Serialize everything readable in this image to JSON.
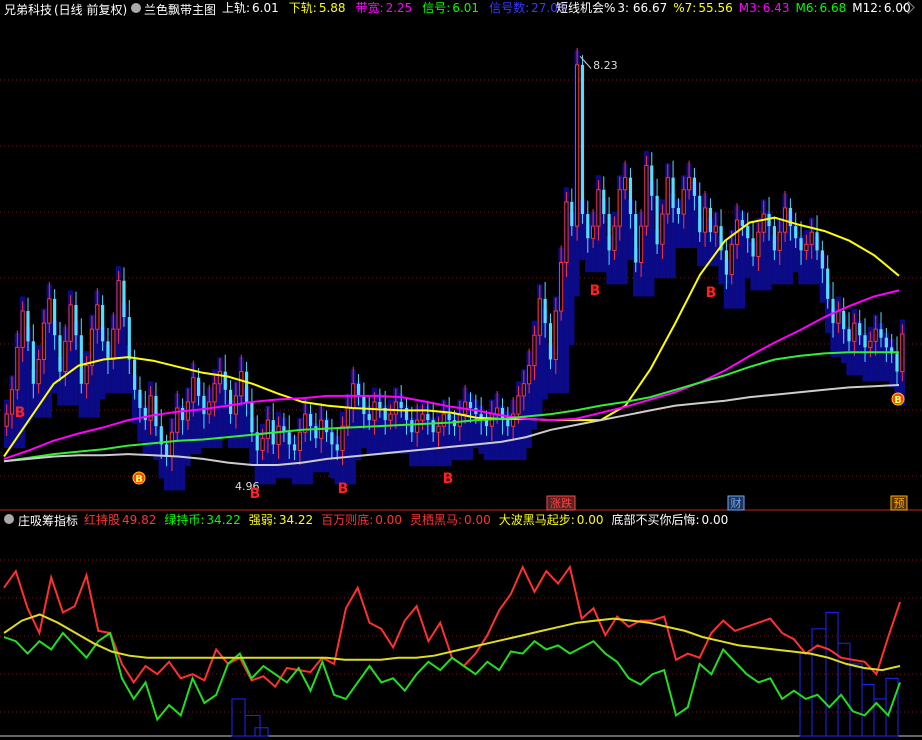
{
  "header": {
    "stock_name": "兄弟科技",
    "period": "(日线 前复权)",
    "indicator_name": "兰色飘带主图",
    "items": [
      {
        "label": "上轨:",
        "value": "6.01",
        "color": "#ffffff"
      },
      {
        "label": "下轨:",
        "value": "5.88",
        "color": "#ffff00"
      },
      {
        "label": "带宽:",
        "value": "2.25",
        "color": "#ff00ff"
      },
      {
        "label": "信号:",
        "value": "6.01",
        "color": "#00ff00"
      },
      {
        "label": "信号数:",
        "value": "27.00",
        "color": "#3a3aff"
      }
    ],
    "ma": [
      {
        "label": "短线机会%",
        "value": "3: 66.67",
        "color": "#ffffff"
      },
      {
        "label": "%7:",
        "value": "55.56",
        "color": "#ffff00"
      },
      {
        "label": "M3:",
        "value": "6.43",
        "color": "#ff00ff"
      },
      {
        "label": "M6:",
        "value": "6.68",
        "color": "#00ff00"
      },
      {
        "label": "M12:",
        "value": "6.00",
        "color": "#ffffff"
      }
    ]
  },
  "sub_header": {
    "indicator_name": "庄吸筹指标",
    "items": [
      {
        "label": "红持股",
        "value": "49.82",
        "color": "#ff3333"
      },
      {
        "label": "绿持币:",
        "value": "34.22",
        "color": "#00ff00"
      },
      {
        "label": "强弱:",
        "value": "34.22",
        "color": "#ffff00"
      },
      {
        "label": "百万则底:",
        "value": "0.00",
        "color": "#ff3333"
      },
      {
        "label": "灵栖黑马:",
        "value": "0.00",
        "color": "#ff3333"
      },
      {
        "label": "大波黑马起步:",
        "value": "0.00",
        "color": "#ffff00"
      },
      {
        "label": "底部不买你后悔:",
        "value": "0.00",
        "color": "#ffffff"
      }
    ]
  },
  "annotations": {
    "high_label": "8.23",
    "low_label": "4.96",
    "b_mark": "B",
    "b_circle_mark": "B",
    "events": [
      {
        "text": "涨跌",
        "color": "#ff4444",
        "bg": "#552222"
      },
      {
        "text": "财",
        "color": "#66aaff",
        "bg": "#223355"
      },
      {
        "text": "预",
        "color": "#ffaa00",
        "bg": "#553311"
      }
    ]
  },
  "chart_data": [
    {
      "type": "candlestick",
      "title": "兰色飘带主图",
      "ylim": [
        4.6,
        8.6
      ],
      "close": [
        5.35,
        5.55,
        5.9,
        6.2,
        5.95,
        5.6,
        5.8,
        6.1,
        6.3,
        6.0,
        5.7,
        5.95,
        6.25,
        6.0,
        5.6,
        5.75,
        6.05,
        6.25,
        5.95,
        5.8,
        6.05,
        6.45,
        6.15,
        5.8,
        5.55,
        5.4,
        5.3,
        5.5,
        5.25,
        5.1,
        5.0,
        5.2,
        5.4,
        5.3,
        5.45,
        5.65,
        5.5,
        5.35,
        5.45,
        5.6,
        5.7,
        5.55,
        5.35,
        5.5,
        5.7,
        5.45,
        5.2,
        5.05,
        5.15,
        5.3,
        5.1,
        5.25,
        5.2,
        5.1,
        5.05,
        5.2,
        5.35,
        5.25,
        5.15,
        5.3,
        5.2,
        5.1,
        5.05,
        5.25,
        5.4,
        5.6,
        5.5,
        5.35,
        5.3,
        5.45,
        5.4,
        5.3,
        5.35,
        5.45,
        5.4,
        5.3,
        5.2,
        5.3,
        5.35,
        5.3,
        5.2,
        5.25,
        5.35,
        5.3,
        5.25,
        5.35,
        5.45,
        5.4,
        5.35,
        5.3,
        5.25,
        5.35,
        5.4,
        5.3,
        5.25,
        5.35,
        5.5,
        5.6,
        5.75,
        6.0,
        6.3,
        6.1,
        5.8,
        6.2,
        6.6,
        7.1,
        6.9,
        8.23,
        7.0,
        6.8,
        6.9,
        7.2,
        7.0,
        6.7,
        6.9,
        7.2,
        7.3,
        7.0,
        6.6,
        6.9,
        7.4,
        7.15,
        6.75,
        7.0,
        7.3,
        7.05,
        7.0,
        7.2,
        7.3,
        7.15,
        6.85,
        7.05,
        6.85,
        6.9,
        6.7,
        6.5,
        6.75,
        6.95,
        6.9,
        6.8,
        6.65,
        6.85,
        7.0,
        6.9,
        6.7,
        6.85,
        7.05,
        6.9,
        6.8,
        6.7,
        6.75,
        6.85,
        6.7,
        6.55,
        6.3,
        6.1,
        6.2,
        6.05,
        5.95,
        6.1,
        6.0,
        5.9,
        5.95,
        6.05,
        5.98,
        5.9,
        5.85,
        5.7,
        6.01
      ],
      "series": [
        {
          "name": "",
          "color": "#ffff00",
          "values": [
            5.0,
            5.3,
            5.6,
            5.75,
            5.8,
            5.82,
            5.79,
            5.74,
            5.69,
            5.66,
            5.6,
            5.52,
            5.45,
            5.42,
            5.4,
            5.39,
            5.38,
            5.38,
            5.36,
            5.32,
            5.31,
            5.31,
            5.3,
            5.3,
            5.3,
            5.42,
            5.72,
            6.1,
            6.5,
            6.78,
            6.93,
            6.97,
            6.91,
            6.86,
            6.78,
            6.66,
            6.49
          ]
        },
        {
          "name": "",
          "color": "#ff00ff",
          "values": [
            4.98,
            5.05,
            5.13,
            5.19,
            5.24,
            5.3,
            5.34,
            5.37,
            5.39,
            5.42,
            5.45,
            5.47,
            5.48,
            5.5,
            5.5,
            5.5,
            5.49,
            5.45,
            5.41,
            5.38,
            5.34,
            5.31,
            5.3,
            5.31,
            5.36,
            5.41,
            5.47,
            5.53,
            5.61,
            5.71,
            5.83,
            5.94,
            6.04,
            6.15,
            6.24,
            6.32,
            6.37
          ]
        },
        {
          "name": "",
          "color": "#33ee33",
          "values": [
            4.96,
            4.99,
            5.02,
            5.04,
            5.06,
            5.09,
            5.11,
            5.13,
            5.14,
            5.16,
            5.18,
            5.2,
            5.22,
            5.23,
            5.24,
            5.25,
            5.26,
            5.27,
            5.28,
            5.3,
            5.31,
            5.33,
            5.35,
            5.38,
            5.42,
            5.45,
            5.49,
            5.55,
            5.61,
            5.67,
            5.74,
            5.8,
            5.83,
            5.85,
            5.86,
            5.86,
            5.86
          ]
        },
        {
          "name": "",
          "color": "#cccccc",
          "values": [
            4.96,
            4.98,
            5.0,
            5.01,
            5.01,
            5.02,
            5.01,
            5.0,
            4.98,
            4.95,
            4.93,
            4.93,
            4.95,
            4.98,
            5.0,
            5.02,
            5.04,
            5.06,
            5.08,
            5.1,
            5.12,
            5.16,
            5.22,
            5.26,
            5.3,
            5.34,
            5.38,
            5.42,
            5.44,
            5.46,
            5.49,
            5.51,
            5.53,
            5.55,
            5.57,
            5.58,
            5.59
          ]
        }
      ]
    },
    {
      "type": "line",
      "title": "庄吸筹指标",
      "ylim": [
        0,
        100
      ],
      "series": [
        {
          "name": "红持股",
          "color": "#ff3030",
          "values": [
            72,
            80,
            62,
            50,
            77,
            60,
            63,
            78,
            51,
            50,
            35,
            26,
            34,
            30,
            36,
            28,
            30,
            27,
            42,
            35,
            38,
            27,
            29,
            24,
            33,
            32,
            31,
            38,
            35,
            62,
            72,
            55,
            52,
            43,
            56,
            63,
            46,
            55,
            38,
            34,
            40,
            49,
            61,
            69,
            82,
            70,
            80,
            74,
            82,
            57,
            62,
            49,
            58,
            53,
            56,
            56,
            58,
            37,
            40,
            38,
            50,
            56,
            51,
            53,
            55,
            57,
            50,
            47,
            40,
            44,
            42,
            38,
            37,
            36,
            30,
            48,
            65
          ]
        },
        {
          "name": "绿持币",
          "color": "#22dd22",
          "values": [
            48,
            46,
            40,
            46,
            42,
            50,
            44,
            38,
            46,
            50,
            28,
            18,
            26,
            8,
            15,
            10,
            28,
            16,
            20,
            35,
            40,
            28,
            34,
            30,
            26,
            33,
            22,
            36,
            20,
            18,
            26,
            34,
            26,
            28,
            22,
            30,
            36,
            32,
            38,
            34,
            30,
            36,
            32,
            41,
            40,
            46,
            42,
            44,
            40,
            43,
            46,
            40,
            36,
            28,
            25,
            30,
            32,
            10,
            14,
            35,
            30,
            42,
            36,
            30,
            26,
            28,
            18,
            22,
            18,
            20,
            14,
            20,
            12,
            10,
            16,
            10,
            26
          ]
        },
        {
          "name": "强弱",
          "color": "#dddd22",
          "values": [
            50,
            56,
            59,
            55,
            50,
            45,
            41,
            39,
            38,
            38,
            38,
            38,
            38,
            38,
            38,
            38,
            38,
            38,
            38,
            37,
            37,
            37,
            38,
            38,
            39,
            41,
            43,
            45,
            47,
            49,
            51,
            53,
            55,
            56,
            57,
            56,
            55,
            53,
            51,
            48,
            46,
            44,
            43,
            42,
            41,
            40,
            38,
            35,
            33,
            32,
            34
          ]
        }
      ]
    }
  ]
}
